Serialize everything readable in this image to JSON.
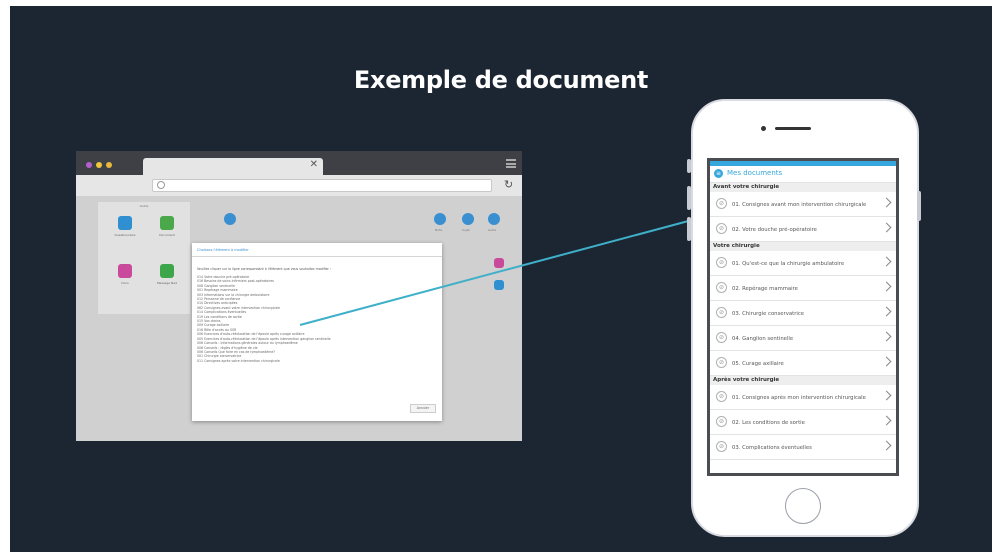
{
  "slide": {
    "title": "Exemple de document"
  },
  "browser": {
    "panel_title": "Outils",
    "tiles": [
      "Questionnaire",
      "Document",
      "Docs",
      "Message Nad"
    ],
    "circle_labels": [
      "Note",
      "Sujet",
      "Autre"
    ],
    "modal": {
      "title": "Choissez l'élément à modifier",
      "intro": "Veuillez cliquer sur la ligne correspondant à l'élément que vous souhaitez modifier :",
      "lines": [
        "014 Votre douche pré-opératoire",
        "016 Besoins de soins infirmiers post-opératoires",
        "008 Ganglion sentinelle",
        "001 Repérage mammaire",
        "003 Informations sur la chirurgie ambulatoire",
        "012 Personne de confiance",
        "010 Directives anticipées",
        "062 Consignes avant votre intervention chirurgicale",
        "014 Complications éventuelles",
        "019 Les conditions de sortie",
        "015 Vos drains",
        "009 Curage axillaire",
        "016 Rôle d'accès au SSR",
        "006 Exercices d'auto-rééducation de l'épaule après curage axillaire",
        "005 Exercices d'auto-rééducation de l'épaule après intervention ganglion sentinelle",
        "006 Conseils : informations générales autour du lymphoedème",
        "006 Conseils : règles d'hygiène de vie",
        "006 Conseils Que faire en cas de lymphoedème?",
        "001 Chirurgie conservatrice",
        "011 Consignes après votre intervention chirurgicale"
      ],
      "button": "Annuler"
    }
  },
  "phone": {
    "app_title": "Mes documents",
    "sections": [
      {
        "heading": "Avant votre chirurgie",
        "items": [
          "01. Consignes avant mon intervention chirurgicale",
          "02. Votre douche pré-opératoire"
        ]
      },
      {
        "heading": "Votre chirurgie",
        "items": [
          "01. Qu'est-ce que la chirurgie ambulatoire",
          "02. Repérage mammaire",
          "03. Chirurgie conservatrice",
          "04. Ganglion sentinelle",
          "05. Curage axillaire"
        ]
      },
      {
        "heading": "Après votre chirurgie",
        "items": [
          "01. Consignes après mon intervention chirurgicale",
          "02. Les conditions de sortie",
          "03. Complications éventuelles"
        ]
      }
    ]
  },
  "colors": {
    "background": "#1c2633",
    "accent": "#35a7dc",
    "connector": "#3fb0c9"
  },
  "icons": {
    "app_header": "document-icon",
    "item": "paperclip-icon",
    "row_action": "chevron-right-icon"
  }
}
